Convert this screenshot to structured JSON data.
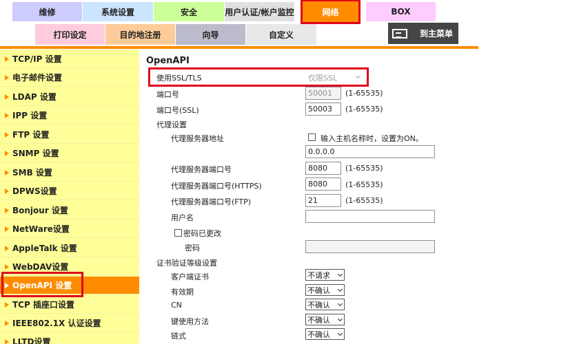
{
  "tabs_row1": [
    "维修",
    "系统设置",
    "安全",
    "用户认证/帐户监控",
    "网络",
    "BOX"
  ],
  "tabs_row2": [
    "打印设定",
    "目的地注册",
    "向导",
    "自定义"
  ],
  "home_label": "到主菜单",
  "sidebar": [
    "TCP/IP 设置",
    "电子邮件设置",
    "LDAP 设置",
    "IPP 设置",
    "FTP 设置",
    "SNMP 设置",
    "SMB 设置",
    "DPWS设置",
    "Bonjour 设置",
    "NetWare设置",
    "AppleTalk 设置",
    "WebDAV设置",
    "OpenAPI 设置",
    "TCP 插座口设置",
    "IEEE802.1X 认证设置",
    "LLTD设置"
  ],
  "main": {
    "section_title": "OpenAPI",
    "use_ssl_label": "使用SSL/TLS",
    "ssl_value": "仅限SSL",
    "port_label": "端口号",
    "port_value": "50001",
    "port_range": "(1-65535)",
    "ssl_port_label": "端口号(SSL)",
    "ssl_port_value": "50003",
    "ssl_port_range": "(1-65535)",
    "proxy_section": "代理设置",
    "proxy_address_label": "代理服务器地址",
    "proxy_host_hint": "输入主机名称时，设置为ON。",
    "proxy_address_value": "0.0.0.0",
    "proxy_port_label": "代理服务器端口号",
    "proxy_port_value": "8080",
    "proxy_port_range": "(1-65535)",
    "proxy_https_label": "代理服务器端口号(HTTPS)",
    "proxy_https_value": "8080",
    "proxy_https_range": "(1-65535)",
    "proxy_ftp_label": "代理服务器端口号(FTP)",
    "proxy_ftp_value": "21",
    "proxy_ftp_range": "(1-65535)",
    "username_label": "用户名",
    "pwd_changed_label": "密码已更改",
    "password_label": "密码",
    "cert_section": "证书验证等级设置",
    "client_cert_label": "客户端证书",
    "client_cert_value": "不请求",
    "validity_label": "有效期",
    "validity_value": "不确认",
    "cn_label": "CN",
    "cn_value": "不确认",
    "key_usage_label": "键使用方法",
    "key_usage_value": "不确认",
    "chain_label": "链式",
    "chain_value": "不确认"
  },
  "colors": {
    "accent": "#ff8c00",
    "sidebar_bg": "#ffff99",
    "highlight_red": "#e0001b",
    "home_bg": "#454545"
  }
}
